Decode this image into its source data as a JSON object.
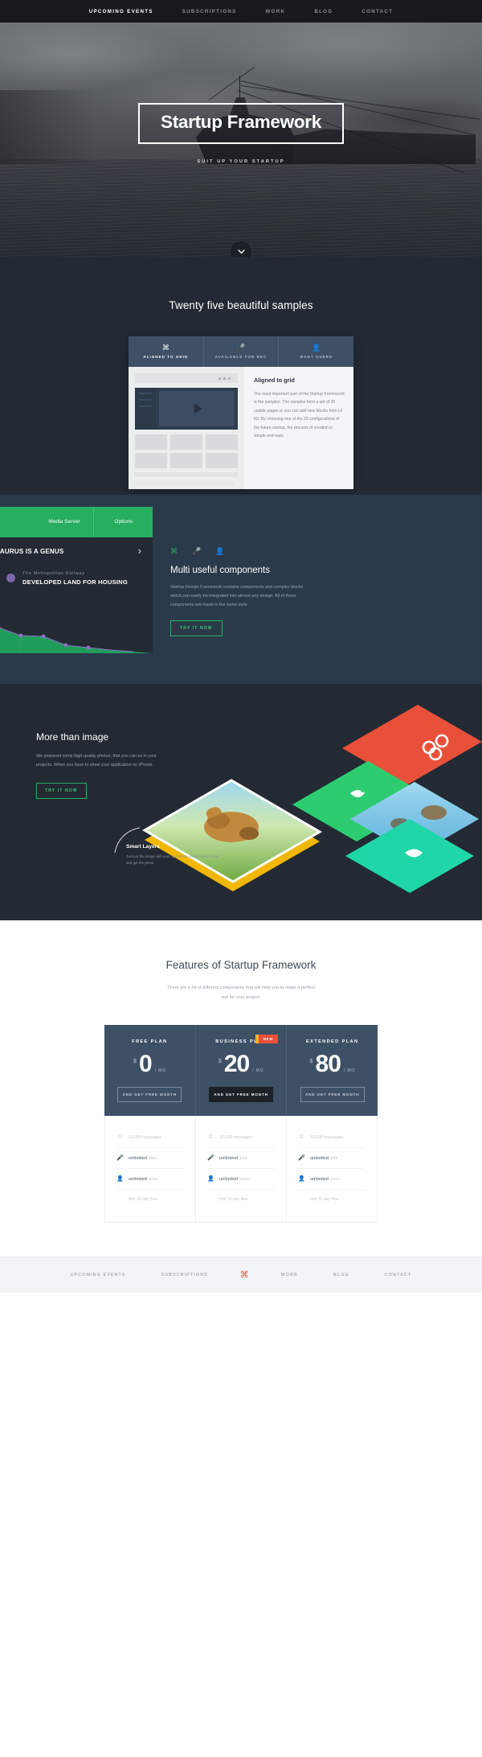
{
  "nav": {
    "items": [
      {
        "label": "UPCOMING EVENTS",
        "active": true
      },
      {
        "label": "SUBSCRIPTIONS",
        "active": false
      },
      {
        "label": "WORK",
        "active": false
      },
      {
        "label": "BLOG",
        "active": false
      },
      {
        "label": "CONTACT",
        "active": false
      }
    ]
  },
  "hero": {
    "title": "Startup Framework",
    "subtitle": "SUIT UP YOUR STARTUP",
    "scroll_icon": "chevron-down-icon"
  },
  "samples": {
    "title": "Twenty five beautiful samples",
    "tabs": [
      {
        "label": "ALIGNED TO GRID",
        "icon": "command-icon",
        "active": true
      },
      {
        "label": "AVAILABLE FOR REC",
        "icon": "microphone-icon",
        "active": false
      },
      {
        "label": "MANY USERS",
        "icon": "user-icon",
        "active": false
      }
    ],
    "panel": {
      "heading": "Aligned to grid",
      "body": "The most important part of the Startup Framework is the samples. The samples form a set of 25 usable pages or you can add new blocks from UI Kit. By choosing one of the 25 configurations of the future startup, the process of creation is simple and easy."
    }
  },
  "components": {
    "green_nav": [
      "Media Server",
      "Options"
    ],
    "strip_title": "ACOSAURUS IS A GENUS",
    "chart_kicker": "The Metropolitan Railway",
    "chart_title": "DEVELOPED LAND FOR HOUSING",
    "icons": [
      "command-icon",
      "microphone-icon",
      "user-icon"
    ],
    "heading": "Multi useful components",
    "body": "Startup Design Framework contains components and complex blocks which can easily be integrated into almost any design. All of these components are made in the same style.",
    "cta": "TRY IT NOW"
  },
  "more": {
    "heading": "More than image",
    "body": "We prepared some high-quality photos, that you can us in your projects. When you have to show your application on iPhone.",
    "cta": "TRY IT NOW",
    "smart_heading": "Smart Layers",
    "smart_body": "Just put the image with your App screen inside Smart Layer and get the photo."
  },
  "features": {
    "title": "Features of Startup Framework",
    "subtitle_line1": "There are a lot of different components that will help you to make a perfect",
    "subtitle_line2": "suit for your project."
  },
  "pricing": {
    "plans": [
      {
        "name": "FREE PLAN",
        "currency": "$",
        "amount": "0",
        "period": "/ MO",
        "button": "AND GET FREE MONTH",
        "button_style": "outline",
        "badge": null
      },
      {
        "name": "BUSINESS PLAN",
        "currency": "$",
        "amount": "20",
        "period": "/ MO",
        "button": "AND GET FREE MONTH",
        "button_style": "solid",
        "badge": "NEW"
      },
      {
        "name": "EXTENDED PLAN",
        "currency": "$",
        "amount": "80",
        "period": "/ MO",
        "button": "AND GET FREE MONTH",
        "button_style": "outline",
        "badge": null
      }
    ],
    "features": [
      {
        "icon": "command-icon",
        "strong": "",
        "text": "10,000 messages"
      },
      {
        "icon": "microphone-icon",
        "strong": "unlimited",
        "text": "data"
      },
      {
        "icon": "user-icon",
        "strong": "unlimited",
        "text": "users"
      },
      {
        "icon": "",
        "strong": "",
        "text": "first 10 day free"
      }
    ]
  },
  "footer": {
    "items_left": [
      "UPCOMING EVENTS",
      "SUBSCRIPTIONS"
    ],
    "logo": "command-icon",
    "items_right": [
      "WORK",
      "BLOG",
      "CONTACT"
    ]
  },
  "colors": {
    "accent_green": "#27ae60",
    "accent_red": "#e8503a",
    "dark": "#232a33",
    "slate": "#3d5066"
  }
}
